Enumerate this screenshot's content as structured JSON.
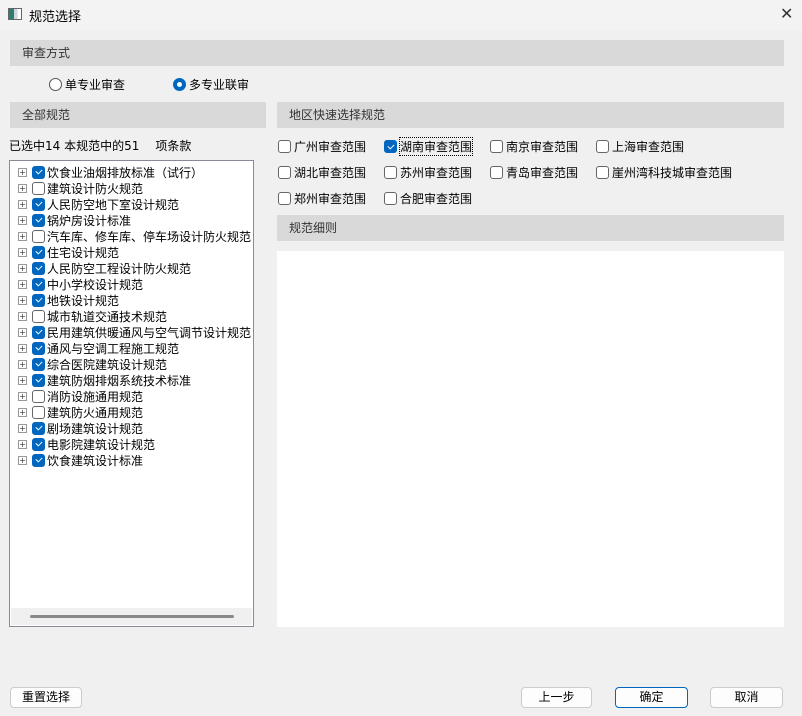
{
  "window": {
    "title": "规范选择",
    "close": "✕"
  },
  "review_mode": {
    "header": "审查方式",
    "options": [
      {
        "label": "单专业审查",
        "selected": false
      },
      {
        "label": "多专业联审",
        "selected": true
      }
    ]
  },
  "all_specs": {
    "header": "全部规范",
    "summary": {
      "prefix": "已选中",
      "selected": "14",
      "middle": "本规范中的",
      "total": "51",
      "suffix": "项条款"
    },
    "items": [
      {
        "label": "饮食业油烟排放标准（试行）",
        "checked": true
      },
      {
        "label": "建筑设计防火规范",
        "checked": false
      },
      {
        "label": "人民防空地下室设计规范",
        "checked": true
      },
      {
        "label": "锅炉房设计标准",
        "checked": true
      },
      {
        "label": "汽车库、修车库、停车场设计防火规范",
        "checked": false
      },
      {
        "label": "住宅设计规范",
        "checked": true
      },
      {
        "label": "人民防空工程设计防火规范",
        "checked": true
      },
      {
        "label": "中小学校设计规范",
        "checked": true
      },
      {
        "label": "地铁设计规范",
        "checked": true
      },
      {
        "label": "城市轨道交通技术规范",
        "checked": false
      },
      {
        "label": "民用建筑供暖通风与空气调节设计规范",
        "checked": true
      },
      {
        "label": "通风与空调工程施工规范",
        "checked": true
      },
      {
        "label": "综合医院建筑设计规范",
        "checked": true
      },
      {
        "label": "建筑防烟排烟系统技术标准",
        "checked": true
      },
      {
        "label": "消防设施通用规范",
        "checked": false
      },
      {
        "label": "建筑防火通用规范",
        "checked": false
      },
      {
        "label": "剧场建筑设计规范",
        "checked": true
      },
      {
        "label": "电影院建筑设计规范",
        "checked": true
      },
      {
        "label": "饮食建筑设计标准",
        "checked": true
      }
    ]
  },
  "regions": {
    "header": "地区快速选择规范",
    "items": [
      {
        "label": "广州审查范围",
        "checked": false
      },
      {
        "label": "湖南审查范围",
        "checked": true
      },
      {
        "label": "南京审查范围",
        "checked": false
      },
      {
        "label": "上海审查范围",
        "checked": false
      },
      {
        "label": "湖北审查范围",
        "checked": false
      },
      {
        "label": "苏州审查范围",
        "checked": false
      },
      {
        "label": "青岛审查范围",
        "checked": false
      },
      {
        "label": "崖州湾科技城审查范围",
        "checked": false
      },
      {
        "label": "郑州审查范围",
        "checked": false
      },
      {
        "label": "合肥审查范围",
        "checked": false
      }
    ]
  },
  "details": {
    "header": "规范细则"
  },
  "buttons": {
    "reset": "重置选择",
    "prev": "上一步",
    "ok": "确定",
    "cancel": "取消"
  }
}
